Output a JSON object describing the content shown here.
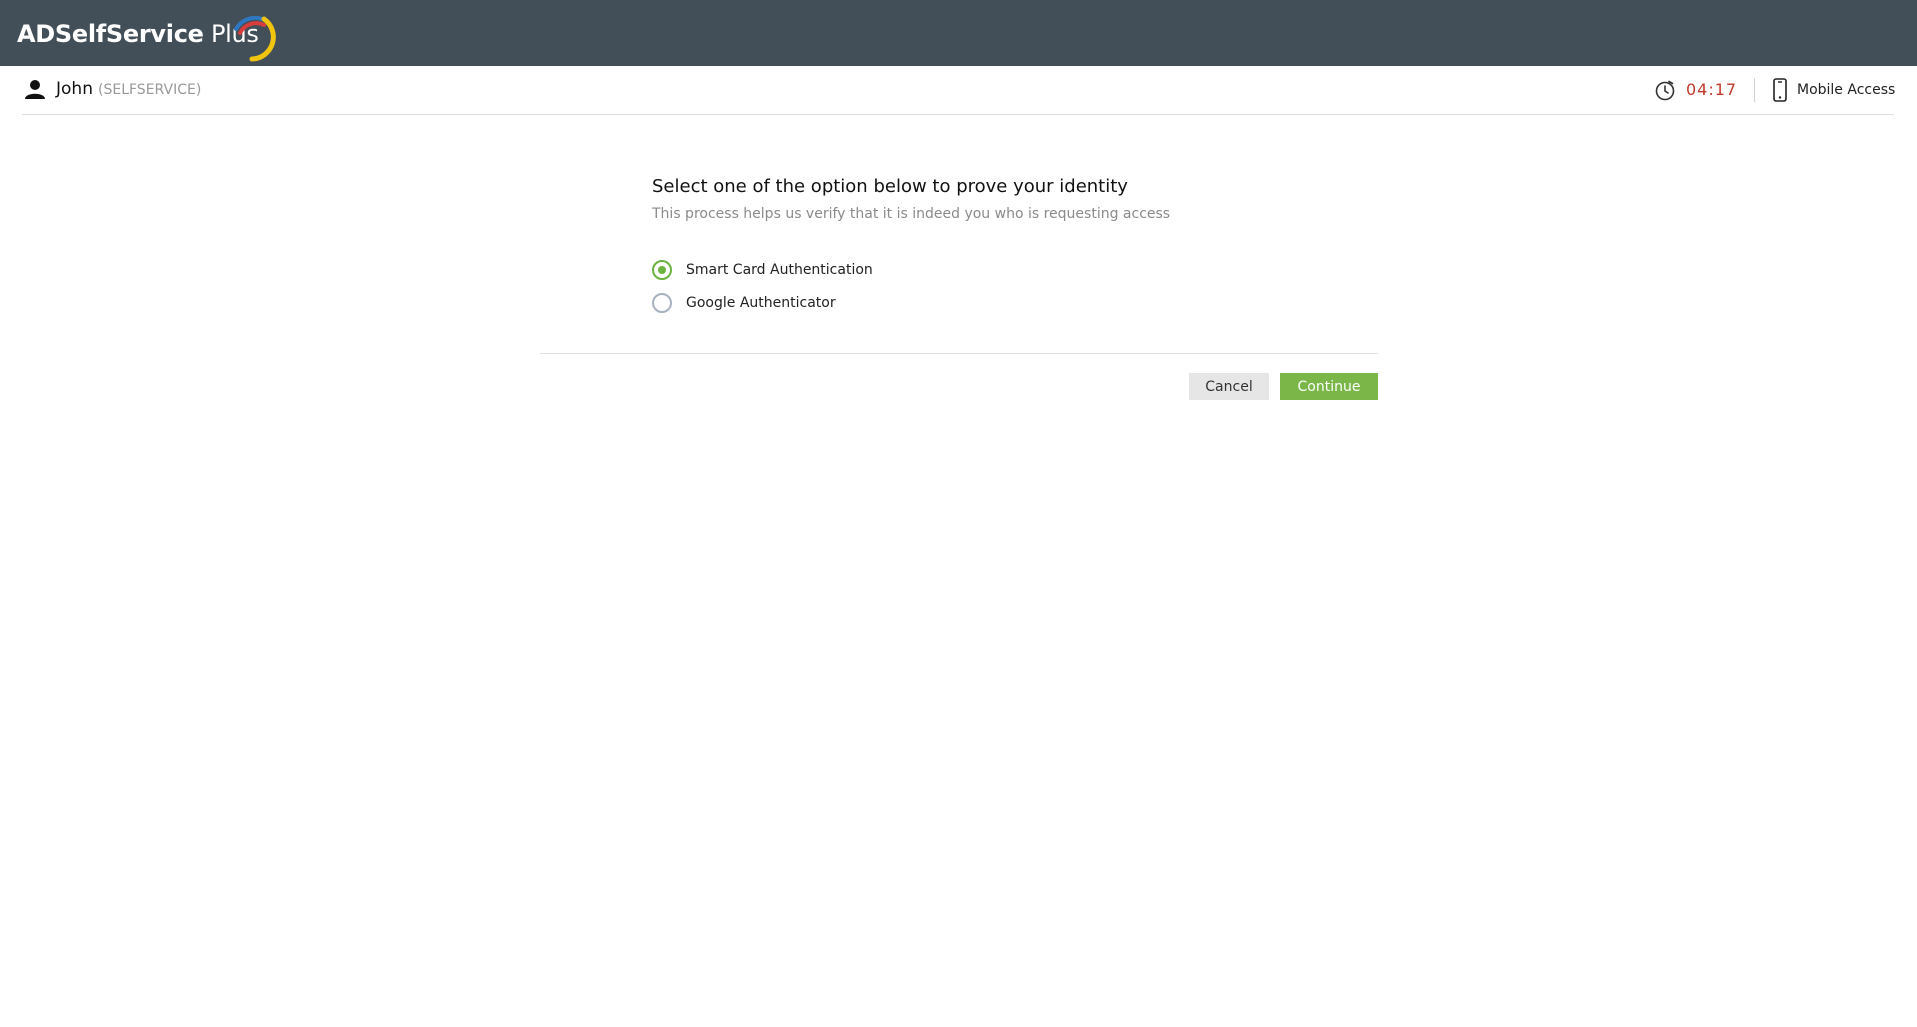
{
  "header": {
    "logo_bold": "ADSelfService",
    "logo_regular": " Plus",
    "background_color": "#434f58",
    "logo_arc_colors": [
      "#2e78c2",
      "#d83c3c",
      "#f1c40f"
    ]
  },
  "userbar": {
    "user_icon": "user-icon",
    "name": "John",
    "domain": "(SELFSERVICE)",
    "timer_icon": "clock-icon",
    "timer": "04:17",
    "timer_color": "#c0392b",
    "mobile_icon": "phone-icon",
    "mobile_label": "Mobile Access"
  },
  "form": {
    "title": "Select one of the option below to prove your identity",
    "subtitle": "This process helps us verify that it is indeed you who is requesting access",
    "options": [
      {
        "label": "Smart Card Authentication",
        "selected": true
      },
      {
        "label": "Google Authenticator",
        "selected": false
      }
    ],
    "cancel_label": "Cancel",
    "continue_label": "Continue",
    "accent_color": "#7ab648"
  }
}
